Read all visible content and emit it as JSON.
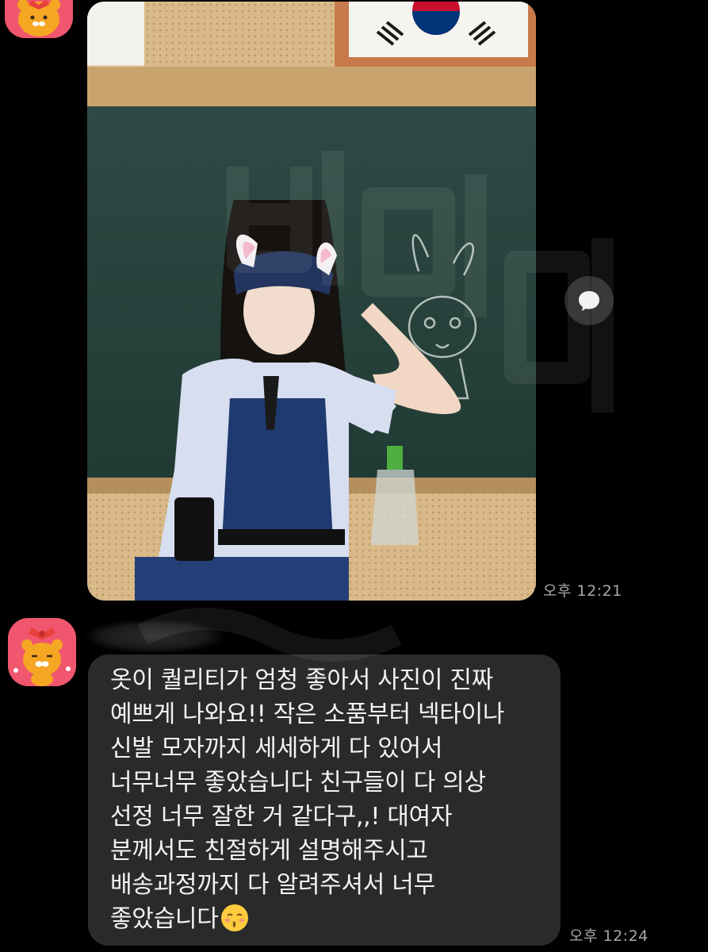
{
  "conversation": {
    "messages": [
      {
        "type": "photo",
        "photo": "student in police costume with bunny ears saluting in front of a chalkboard",
        "time": "오후 12:21"
      },
      {
        "type": "text",
        "lines": [
          "옷이 퀄리티가 엄청 좋아서 사진이 진짜",
          "예쁘게 나와요!! 작은 소품부터 넥타이나",
          "신발 모자까지 세세하게 다 있어서",
          "너무너무 좋았습니다 친구들이 다 의상",
          "선정 너무 잘한 거 같다구,,! 대여자",
          "분께서도 친절하게 설명해주시고",
          "배송과정까지 다 알려주셔서 너무",
          "좋았습니다"
        ],
        "emoji": "kissing-face-with-closed-eyes",
        "time": "오후 12:24"
      }
    ],
    "icons": {
      "avatar": "ryan-character-avatar",
      "share": "speech-bubble-icon"
    },
    "colors": {
      "background": "#000000",
      "bubble": "#2a2a2a",
      "text": "#f3f3f3",
      "timestamp": "#a8a8a8",
      "avatar_bg": "#f0566d"
    }
  }
}
